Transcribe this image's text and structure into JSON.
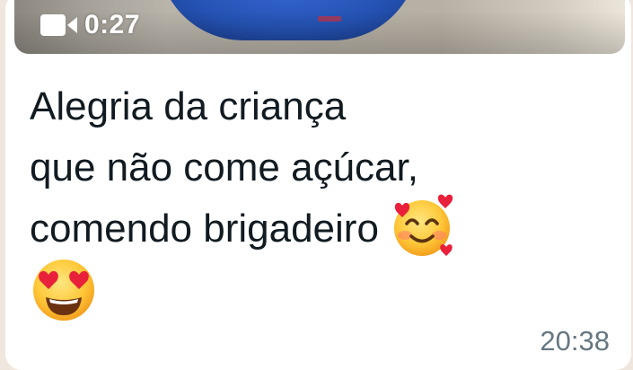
{
  "message": {
    "video": {
      "duration": "0:27",
      "icon": "video-camera-icon"
    },
    "caption": {
      "line1": "Alegria da criança",
      "line2": "que não come açúcar,",
      "line3": "comendo brigadeiro",
      "emoji_inline": "smiling-face-with-hearts-icon",
      "emoji_last": "heart-eyes-face-icon"
    },
    "timestamp": "20:38"
  },
  "colors": {
    "bubble": "#ffffff",
    "text": "#111b21",
    "timestamp": "#667781",
    "chat_background": "#efe7dd",
    "shirt_blue": "#2452b3"
  }
}
